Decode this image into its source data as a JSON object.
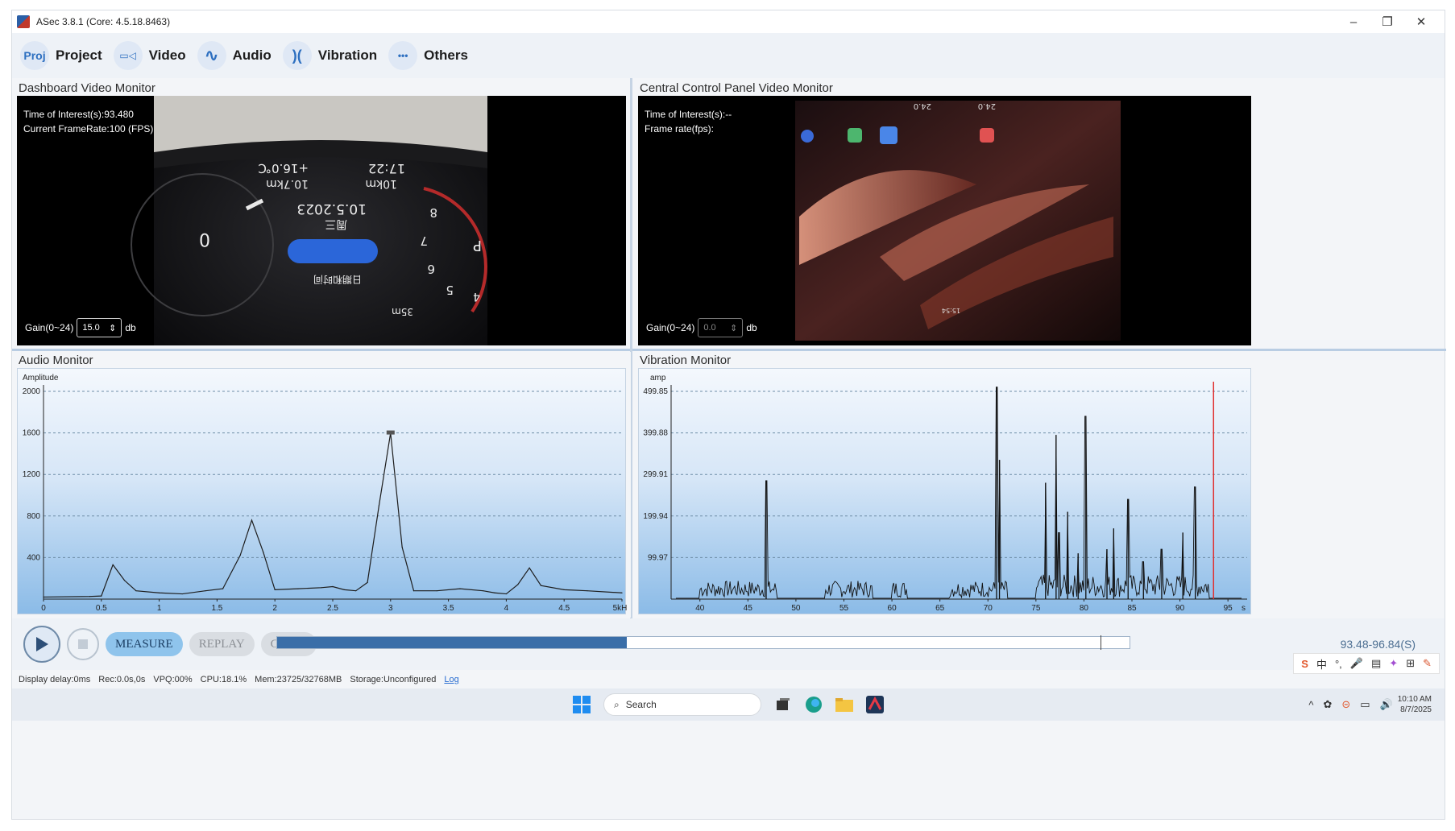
{
  "window": {
    "title": "ASec 3.8.1 (Core: 4.5.18.8463)",
    "minimize": "–",
    "maximize": "❐",
    "close": "✕"
  },
  "toolbar": {
    "items": [
      {
        "icon": "project-icon",
        "glyph": "Proj",
        "label": "Project"
      },
      {
        "icon": "video-icon",
        "glyph": "▭◁",
        "label": "Video"
      },
      {
        "icon": "audio-icon",
        "glyph": "∿",
        "label": "Audio"
      },
      {
        "icon": "vibration-icon",
        "glyph": ")(",
        "label": "Vibration"
      },
      {
        "icon": "others-icon",
        "glyph": "•••",
        "label": "Others"
      }
    ]
  },
  "dashboard_video": {
    "title": "Dashboard Video Monitor",
    "time_of_interest": "Time of Interest(s):93.480",
    "frame_rate": "Current  FrameRate:100  (FPS)",
    "gain_label": "Gain(0~24)",
    "gain_value": "15.0",
    "gain_unit": "db",
    "screen_texts": [
      "17:22",
      "+16.0℃",
      "10.7km",
      "10km",
      "10.5.2023",
      "周三",
      "0",
      "8",
      "7",
      "6",
      "5",
      "4",
      "P",
      "日期和时间",
      "35m"
    ]
  },
  "central_video": {
    "title": "Central Control Panel Video Monitor",
    "time_of_interest": "Time of Interest(s):--",
    "frame_rate": "Frame rate(fps):",
    "gain_label": "Gain(0~24)",
    "gain_value": "0.0",
    "gain_unit": "db",
    "screen_texts": [
      "24.0",
      "24.0",
      "15:54"
    ]
  },
  "audio_monitor": {
    "title": "Audio Monitor"
  },
  "vibration_monitor": {
    "title": "Vibration Monitor"
  },
  "chart_data": [
    {
      "type": "line",
      "ylabel": "Amplitude",
      "xlabel": "kHz",
      "xlim": [
        0,
        5
      ],
      "ylim": [
        0,
        2000
      ],
      "x_ticks": [
        "0",
        "0.5",
        "1",
        "1.5",
        "2",
        "2.5",
        "3",
        "3.5",
        "4",
        "4.5",
        "5kHz"
      ],
      "y_ticks": [
        "400",
        "800",
        "1200",
        "1600",
        "2000"
      ],
      "grid": "horizontal-dashed",
      "series": [
        {
          "x": [
            0,
            0.4,
            0.5,
            0.6,
            0.7,
            0.8,
            1.0,
            1.2,
            1.4,
            1.55,
            1.7,
            1.8,
            1.9,
            2.0,
            2.2,
            2.4,
            2.5,
            2.6,
            2.7,
            2.8,
            2.9,
            3.0,
            3.1,
            3.2,
            3.4,
            3.6,
            3.8,
            3.9,
            4.0,
            4.1,
            4.2,
            4.3,
            4.5,
            4.7,
            5.0
          ],
          "y": [
            20,
            25,
            30,
            330,
            180,
            80,
            60,
            50,
            80,
            100,
            420,
            760,
            450,
            90,
            100,
            110,
            120,
            90,
            80,
            160,
            900,
            1600,
            500,
            80,
            80,
            100,
            80,
            60,
            50,
            140,
            300,
            130,
            90,
            80,
            60
          ]
        }
      ],
      "peak_marker": {
        "x": 3.0,
        "y": 1600
      }
    },
    {
      "type": "line",
      "ylabel": "amp",
      "xlabel": "s",
      "xlim": [
        37,
        97
      ],
      "ylim": [
        0,
        499.85
      ],
      "x_ticks": [
        "40",
        "45",
        "50",
        "55",
        "60",
        "65",
        "70",
        "75",
        "80",
        "85",
        "90",
        "95"
      ],
      "x_unit": "s",
      "y_ticks": [
        "99.97",
        "199.94",
        "299.91",
        "399.88",
        "499.85"
      ],
      "grid": "horizontal-dashed",
      "cursor_x": 93.5,
      "cursor_color": "#e03030",
      "major_peaks": [
        {
          "x": 46.9,
          "y": 285
        },
        {
          "x": 70.9,
          "y": 510
        },
        {
          "x": 71.2,
          "y": 335
        },
        {
          "x": 76.0,
          "y": 280
        },
        {
          "x": 77.1,
          "y": 395
        },
        {
          "x": 77.4,
          "y": 160
        },
        {
          "x": 78.3,
          "y": 210
        },
        {
          "x": 79.4,
          "y": 110
        },
        {
          "x": 80.2,
          "y": 440
        },
        {
          "x": 82.4,
          "y": 120
        },
        {
          "x": 83.1,
          "y": 170
        },
        {
          "x": 84.6,
          "y": 240
        },
        {
          "x": 86.2,
          "y": 90
        },
        {
          "x": 88.1,
          "y": 120
        },
        {
          "x": 90.3,
          "y": 160
        },
        {
          "x": 91.6,
          "y": 270
        }
      ]
    }
  ],
  "transport": {
    "play": "play-icon",
    "stop": "stop-icon",
    "measure": "MEASURE",
    "replay": "REPLAY",
    "calib": "CALIB",
    "progress_fraction": 0.41,
    "marker_fraction": 0.966,
    "range": "93.48-96.84(S)"
  },
  "status": {
    "display_delay": "Display delay:0ms",
    "rec": "Rec:0.0s,0s",
    "vpq": "VPQ:00%",
    "cpu": "CPU:18.1%",
    "mem": "Mem:23725/32768MB",
    "storage": "Storage:Unconfigured",
    "log": "Log"
  },
  "tray_mini": [
    "S",
    "中",
    "°,",
    "🎤",
    "▤",
    "✦",
    "⊞",
    "✎"
  ],
  "taskbar": {
    "search_placeholder": "Search",
    "time": "10:10 AM",
    "date": "8/7/2025",
    "tray": [
      "^",
      "✿",
      "⊝",
      "▭",
      "🔊"
    ]
  }
}
